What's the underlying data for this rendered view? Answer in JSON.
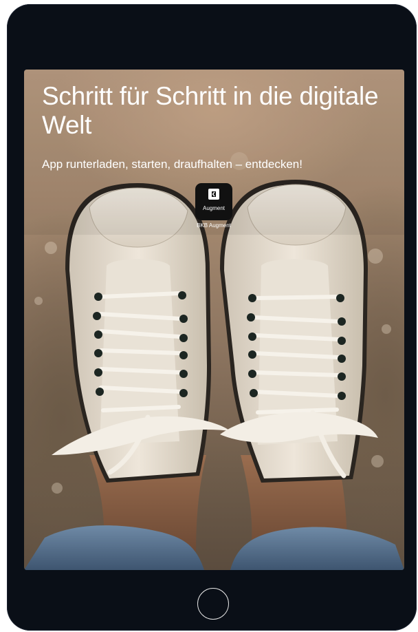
{
  "screen": {
    "headline": "Schritt für Schritt in die digitale Welt",
    "subline": "App runterladen, starten, draufhalten – entdecken!",
    "app": {
      "tile_label": "Augment",
      "name": "BKB Augment",
      "icon": "bkb-logo-icon"
    },
    "photo": "sneakers-photo"
  },
  "colors": {
    "device_frame": "#0a0f17",
    "text": "#ffffff",
    "app_tile": "#111111"
  }
}
